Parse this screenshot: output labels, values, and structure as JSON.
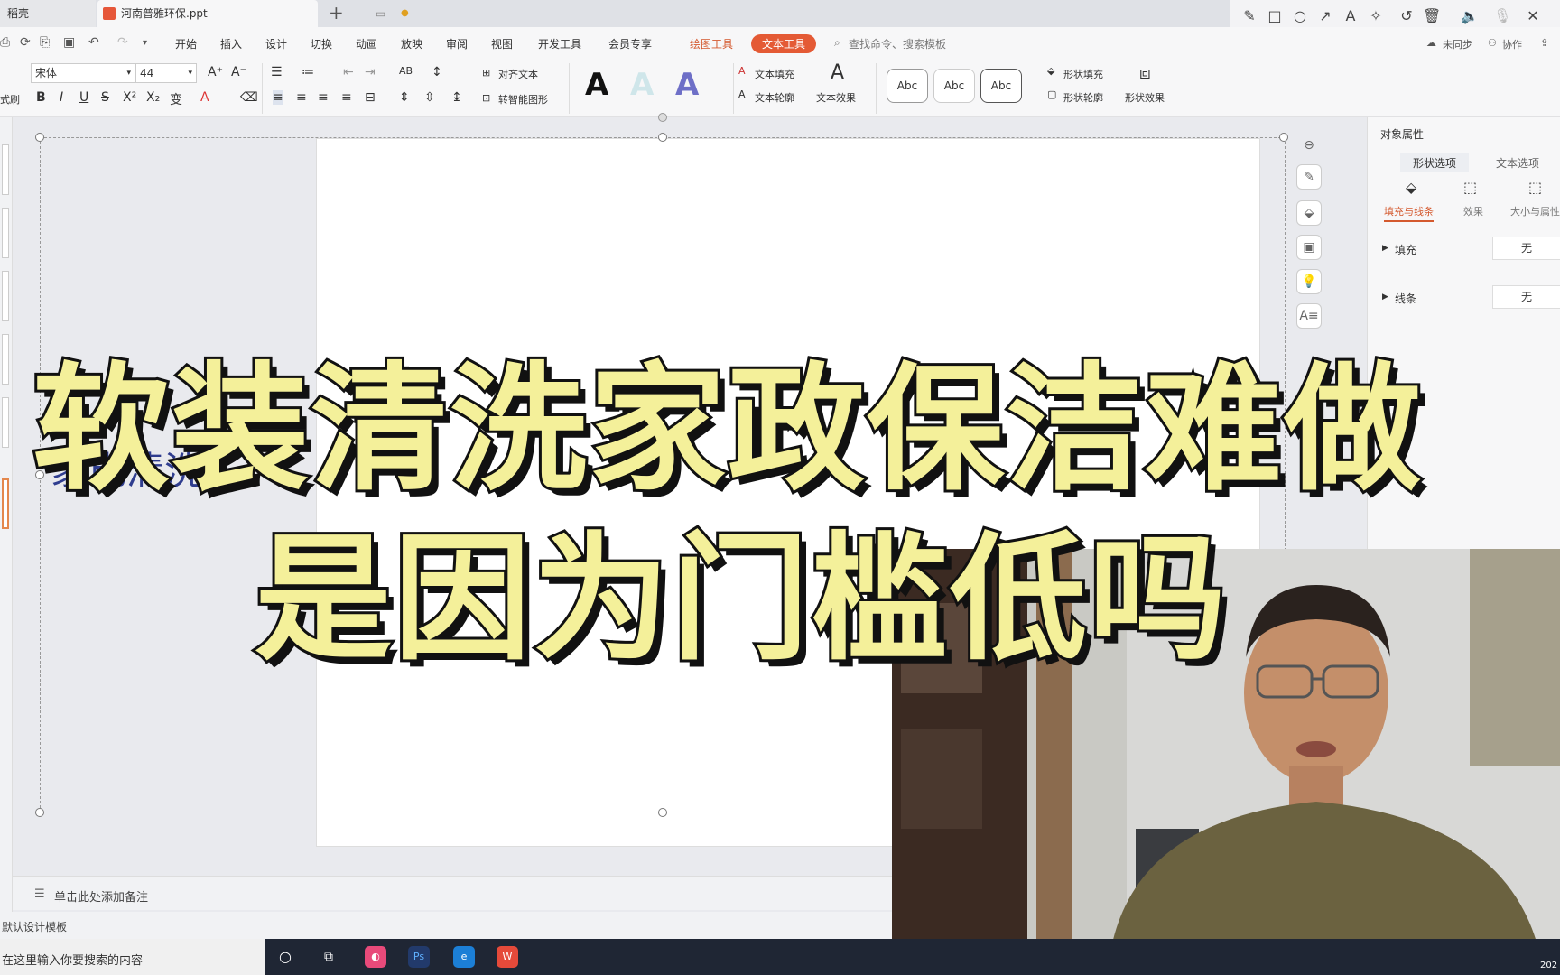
{
  "tabs": {
    "home": "稻壳",
    "doc": "河南普雅环保.ppt"
  },
  "menu": {
    "items": [
      "开始",
      "插入",
      "设计",
      "切换",
      "动画",
      "放映",
      "审阅",
      "视图",
      "开发工具",
      "会员专享"
    ],
    "draw_tools": "绘图工具",
    "text_tools": "文本工具",
    "search_placeholder": "查找命令、搜索模板",
    "unsynced": "未同步",
    "collab": "协作"
  },
  "ribbon": {
    "font_name": "宋体",
    "font_size": "44",
    "align_text": "对齐文本",
    "smart_shape": "转智能图形",
    "text_fill": "文本填充",
    "text_outline": "文本轮廓",
    "text_effect": "文本效果",
    "shape_fill": "形状填充",
    "shape_outline": "形状轮廓",
    "shape_effect": "形状效果",
    "abc": "Abc",
    "style_a": "A",
    "paint_label": "式刷"
  },
  "slide": {
    "text": "家电清洗,"
  },
  "notes": {
    "placeholder": "单击此处添加备注"
  },
  "status": {
    "template": "默认设计模板"
  },
  "taskbar": {
    "search": "在这里输入你要搜索的内容",
    "clock": "202"
  },
  "panel": {
    "title": "对象属性",
    "tab_shape": "形状选项",
    "tab_text": "文本选项",
    "sub_fill": "填充与线条",
    "sub_effect": "效果",
    "sub_size": "大小与属性",
    "fill_label": "填充",
    "fill_value": "无",
    "line_label": "线条",
    "line_value": "无"
  },
  "headline": {
    "line1": "软装清洗家政保洁难做",
    "line2": "是因为门槛低吗"
  },
  "colors": {
    "accent": "#e45a35",
    "headline_fill": "#f4f09a",
    "headline_stroke": "#111111",
    "slide_text": "#2f3d8f"
  }
}
